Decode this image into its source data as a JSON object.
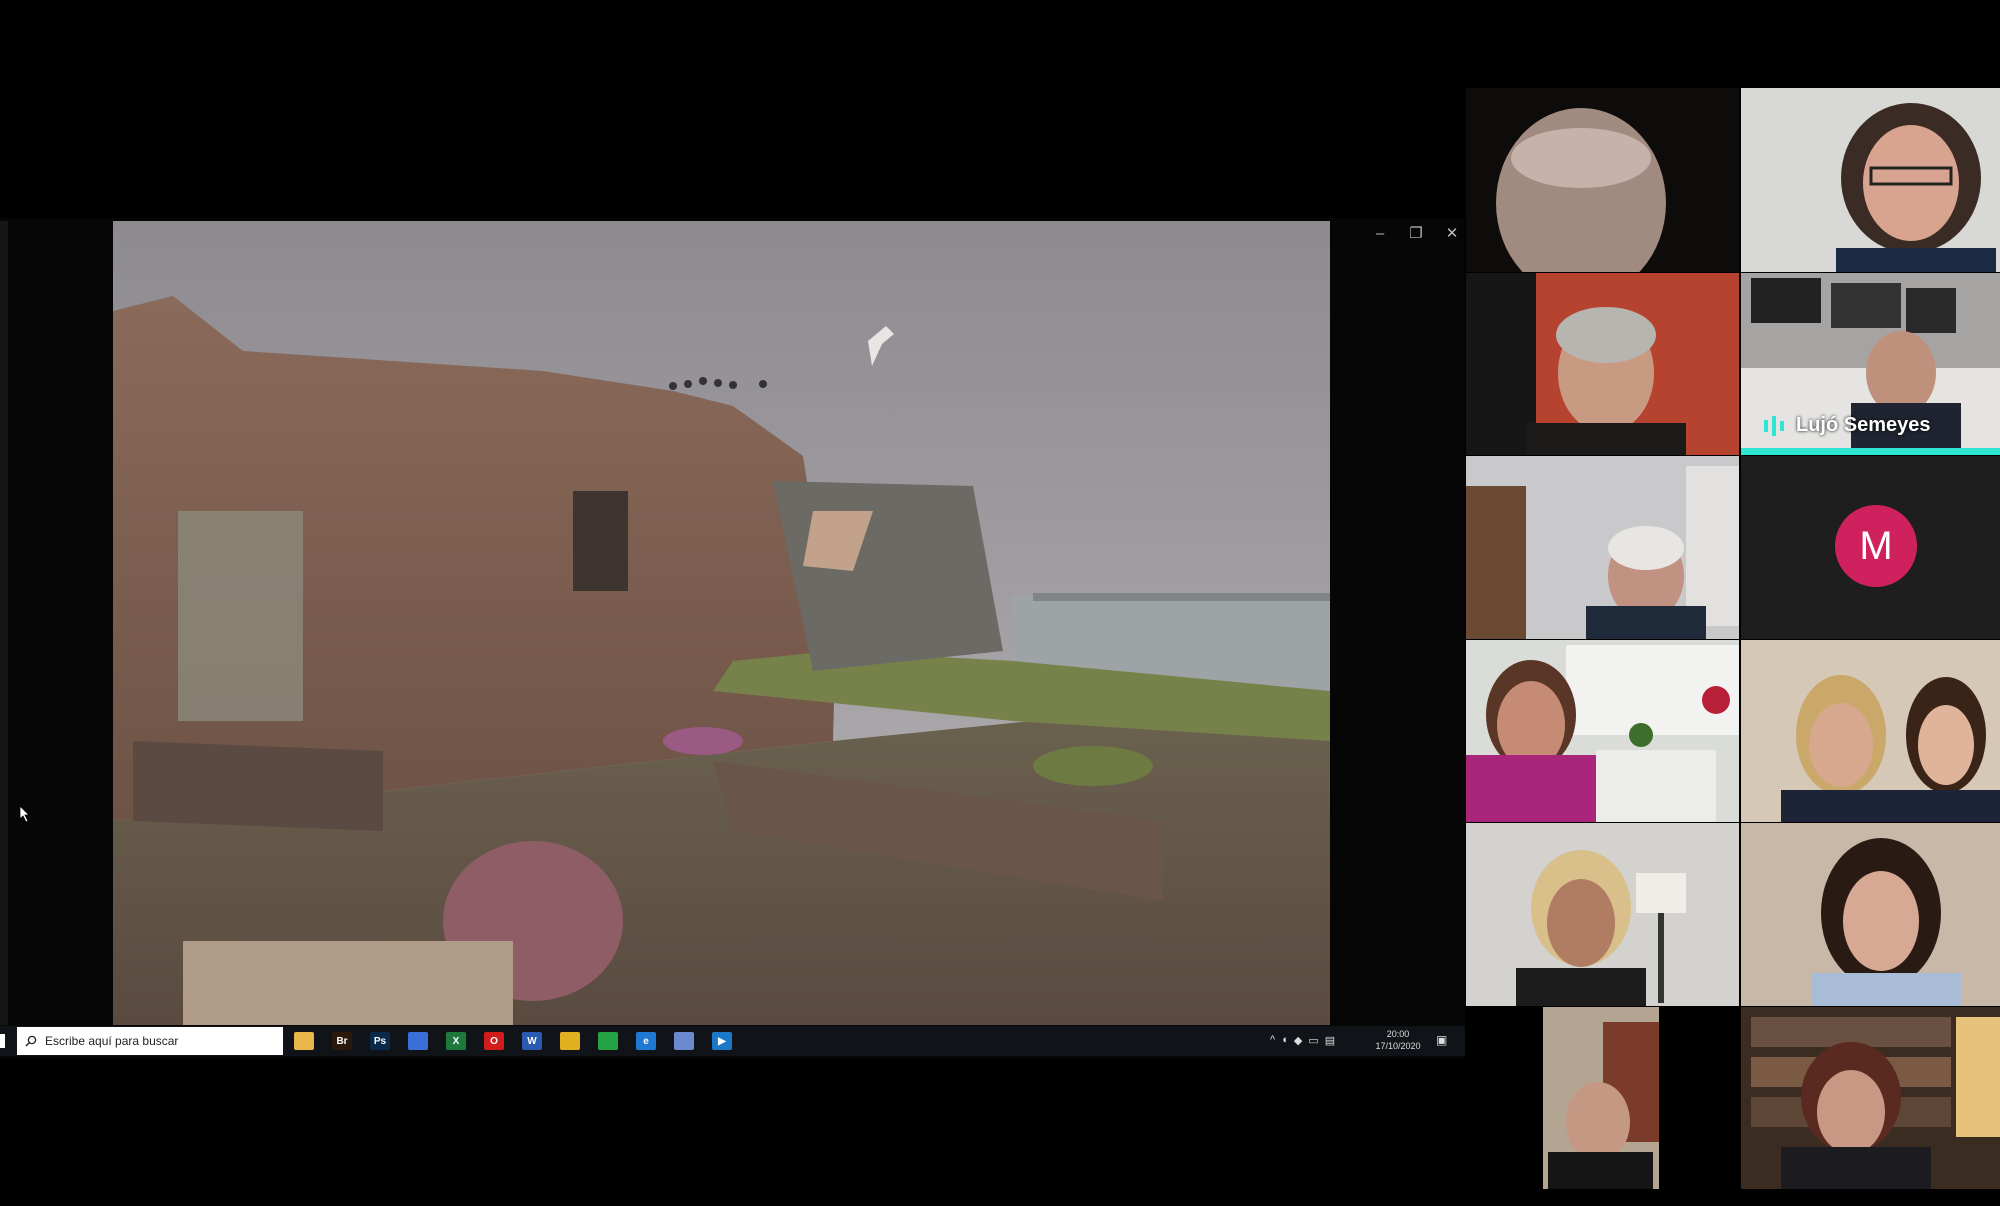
{
  "shared_screen": {
    "window_controls": {
      "minimize": "–",
      "restore": "❐",
      "close": "✕"
    },
    "taskbar": {
      "search_placeholder": "Escribe aquí para buscar",
      "apps": [
        {
          "name": "file-explorer",
          "label": "",
          "color": "#e8b64a"
        },
        {
          "name": "bridge",
          "label": "Br",
          "color": "#2b1a0c"
        },
        {
          "name": "photoshop",
          "label": "Ps",
          "color": "#0b2a4a"
        },
        {
          "name": "book-app",
          "label": "",
          "color": "#3a6fd8"
        },
        {
          "name": "excel",
          "label": "X",
          "color": "#1e7a3c"
        },
        {
          "name": "opera",
          "label": "O",
          "color": "#d21c1c"
        },
        {
          "name": "word",
          "label": "W",
          "color": "#2a5bb0"
        },
        {
          "name": "chrome",
          "label": "",
          "color": "#e0b020"
        },
        {
          "name": "whatsapp",
          "label": "",
          "color": "#25a244"
        },
        {
          "name": "edge",
          "label": "e",
          "color": "#1f78d1"
        },
        {
          "name": "network-app",
          "label": "",
          "color": "#6a8ad0"
        },
        {
          "name": "media-app",
          "label": "▶",
          "color": "#1b78c8"
        }
      ],
      "clock_time": "20:00",
      "clock_date": "17/10/2020"
    }
  },
  "participants": [
    {
      "id": "p1"
    },
    {
      "id": "p2"
    },
    {
      "id": "p3"
    },
    {
      "id": "p4",
      "name": "Lujó Semeyes",
      "speaking": true
    },
    {
      "id": "p5"
    },
    {
      "id": "p6",
      "initial": "M",
      "avatar_color": "#d0215f"
    },
    {
      "id": "p7"
    },
    {
      "id": "p8"
    },
    {
      "id": "p9"
    },
    {
      "id": "p10"
    },
    {
      "id": "p11"
    },
    {
      "id": "p12"
    }
  ]
}
